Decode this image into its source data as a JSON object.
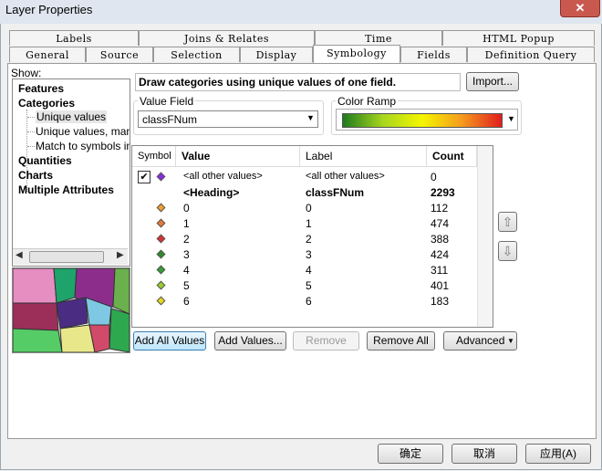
{
  "window": {
    "title": "Layer Properties",
    "close_label": "✕"
  },
  "tabs_row1": [
    "Labels",
    "Joins & Relates",
    "Time",
    "HTML Popup"
  ],
  "tabs_row2": [
    "General",
    "Source",
    "Selection",
    "Display",
    "Symbology",
    "Fields",
    "Definition Query"
  ],
  "show": {
    "label": "Show:",
    "items": [
      "Features",
      "Categories",
      "Unique values",
      "Unique values, many",
      "Match to symbols in a",
      "Quantities",
      "Charts",
      "Multiple Attributes"
    ]
  },
  "description": "Draw categories using unique values of one field.",
  "import_label": "Import...",
  "value_field": {
    "label": "Value Field",
    "value": "classFNum"
  },
  "color_ramp": {
    "label": "Color Ramp",
    "colors": [
      "#1e7a1e",
      "#a6d61e",
      "#f5f500",
      "#f59a1e",
      "#e01e1e"
    ]
  },
  "table": {
    "headers": [
      "Symbol",
      "Value",
      "Label",
      "Count"
    ],
    "rows": [
      {
        "value": "<all other values>",
        "label": "<all other values>",
        "count": "0",
        "color": "#8a2be2",
        "checked": true
      },
      {
        "value": "<Heading>",
        "label": "classFNum",
        "count": "2293",
        "heading": true
      },
      {
        "value": "0",
        "label": "0",
        "count": "112",
        "color": "#f0a030"
      },
      {
        "value": "1",
        "label": "1",
        "count": "474",
        "color": "#e67a3a"
      },
      {
        "value": "2",
        "label": "2",
        "count": "388",
        "color": "#d83030"
      },
      {
        "value": "3",
        "label": "3",
        "count": "424",
        "color": "#2e8b2e"
      },
      {
        "value": "4",
        "label": "4",
        "count": "311",
        "color": "#33a033"
      },
      {
        "value": "5",
        "label": "5",
        "count": "401",
        "color": "#9acd32"
      },
      {
        "value": "6",
        "label": "6",
        "count": "183",
        "color": "#e8d820"
      }
    ]
  },
  "buttons": {
    "add_all": "Add All Values",
    "add": "Add Values...",
    "remove": "Remove",
    "remove_all": "Remove All",
    "advanced": "Advanced"
  },
  "footer": {
    "ok": "确定",
    "cancel": "取消",
    "apply": "应用(A)"
  }
}
